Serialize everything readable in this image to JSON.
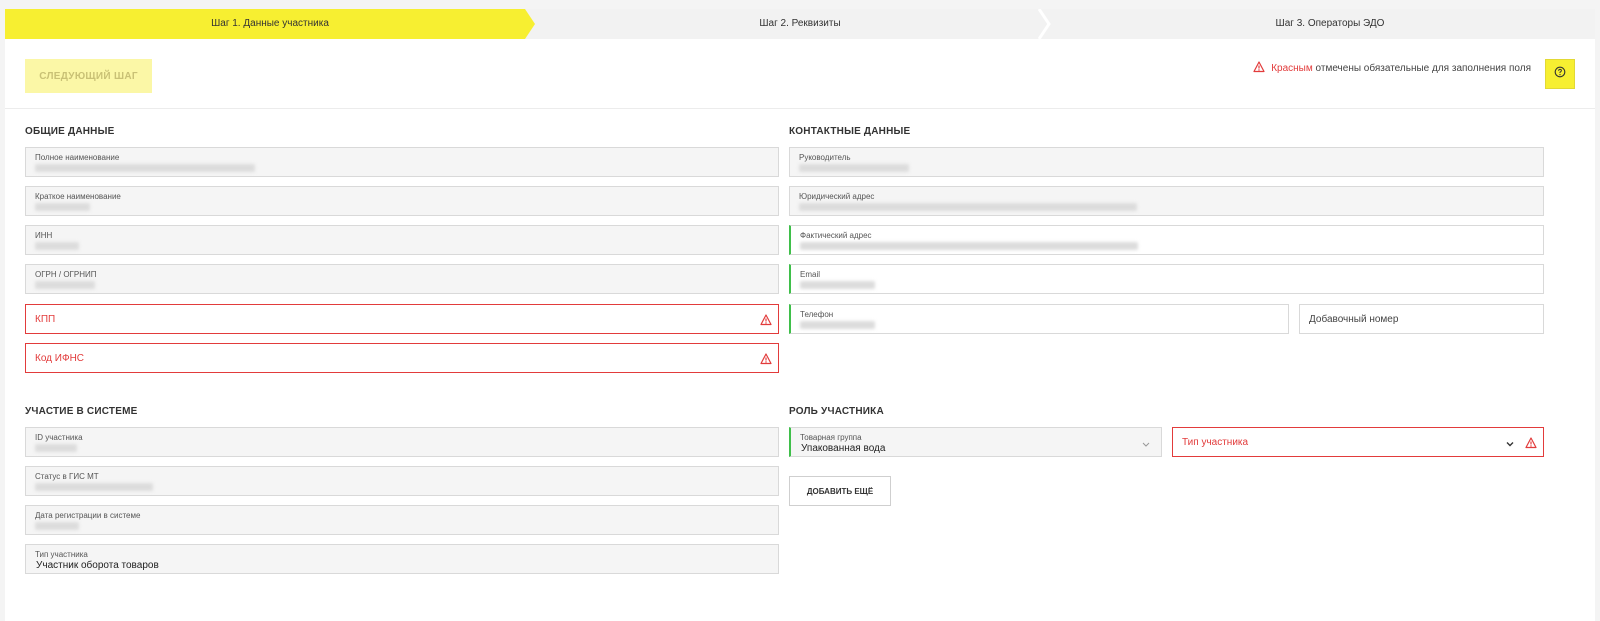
{
  "stepper": {
    "steps": [
      {
        "label": "Шаг 1. Данные участника",
        "active": true
      },
      {
        "label": "Шаг 2. Реквизиты",
        "active": false
      },
      {
        "label": "Шаг 3. Операторы ЭДО",
        "active": false
      }
    ]
  },
  "toolbar": {
    "next_label": "Следующий шаг",
    "hint_red": "Красным",
    "hint_rest": "отмечены обязательные для заполнения поля"
  },
  "general": {
    "title": "Общие данные",
    "full_name_label": "Полное наименование",
    "short_name_label": "Краткое наименование",
    "inn_label": "ИНН",
    "ogrn_label": "ОГРН / ОГРНИП",
    "kpp_placeholder": "КПП",
    "ifns_placeholder": "Код ИФНС"
  },
  "contacts": {
    "title": "Контактные данные",
    "director_label": "Руководитель",
    "legal_address_label": "Юридический адрес",
    "actual_address_label": "Фактический адрес",
    "email_label": "Email",
    "phone_label": "Телефон",
    "extension_placeholder": "Добавочный номер"
  },
  "participation": {
    "title": "Участие в системе",
    "id_label": "ID участника",
    "status_label": "Статус в ГИС МТ",
    "reg_date_label": "Дата регистрации в системе",
    "type_label": "Тип участника",
    "type_value": "Участник оборота товаров"
  },
  "role": {
    "title": "Роль участника",
    "product_group_label": "Товарная группа",
    "product_group_value": "Упакованная вода",
    "participant_type_placeholder": "Тип участника",
    "add_more_label": "Добавить ещё"
  },
  "colors": {
    "accent": "#f7ef31",
    "error": "#e23b3b",
    "valid": "#3fbf4a"
  }
}
